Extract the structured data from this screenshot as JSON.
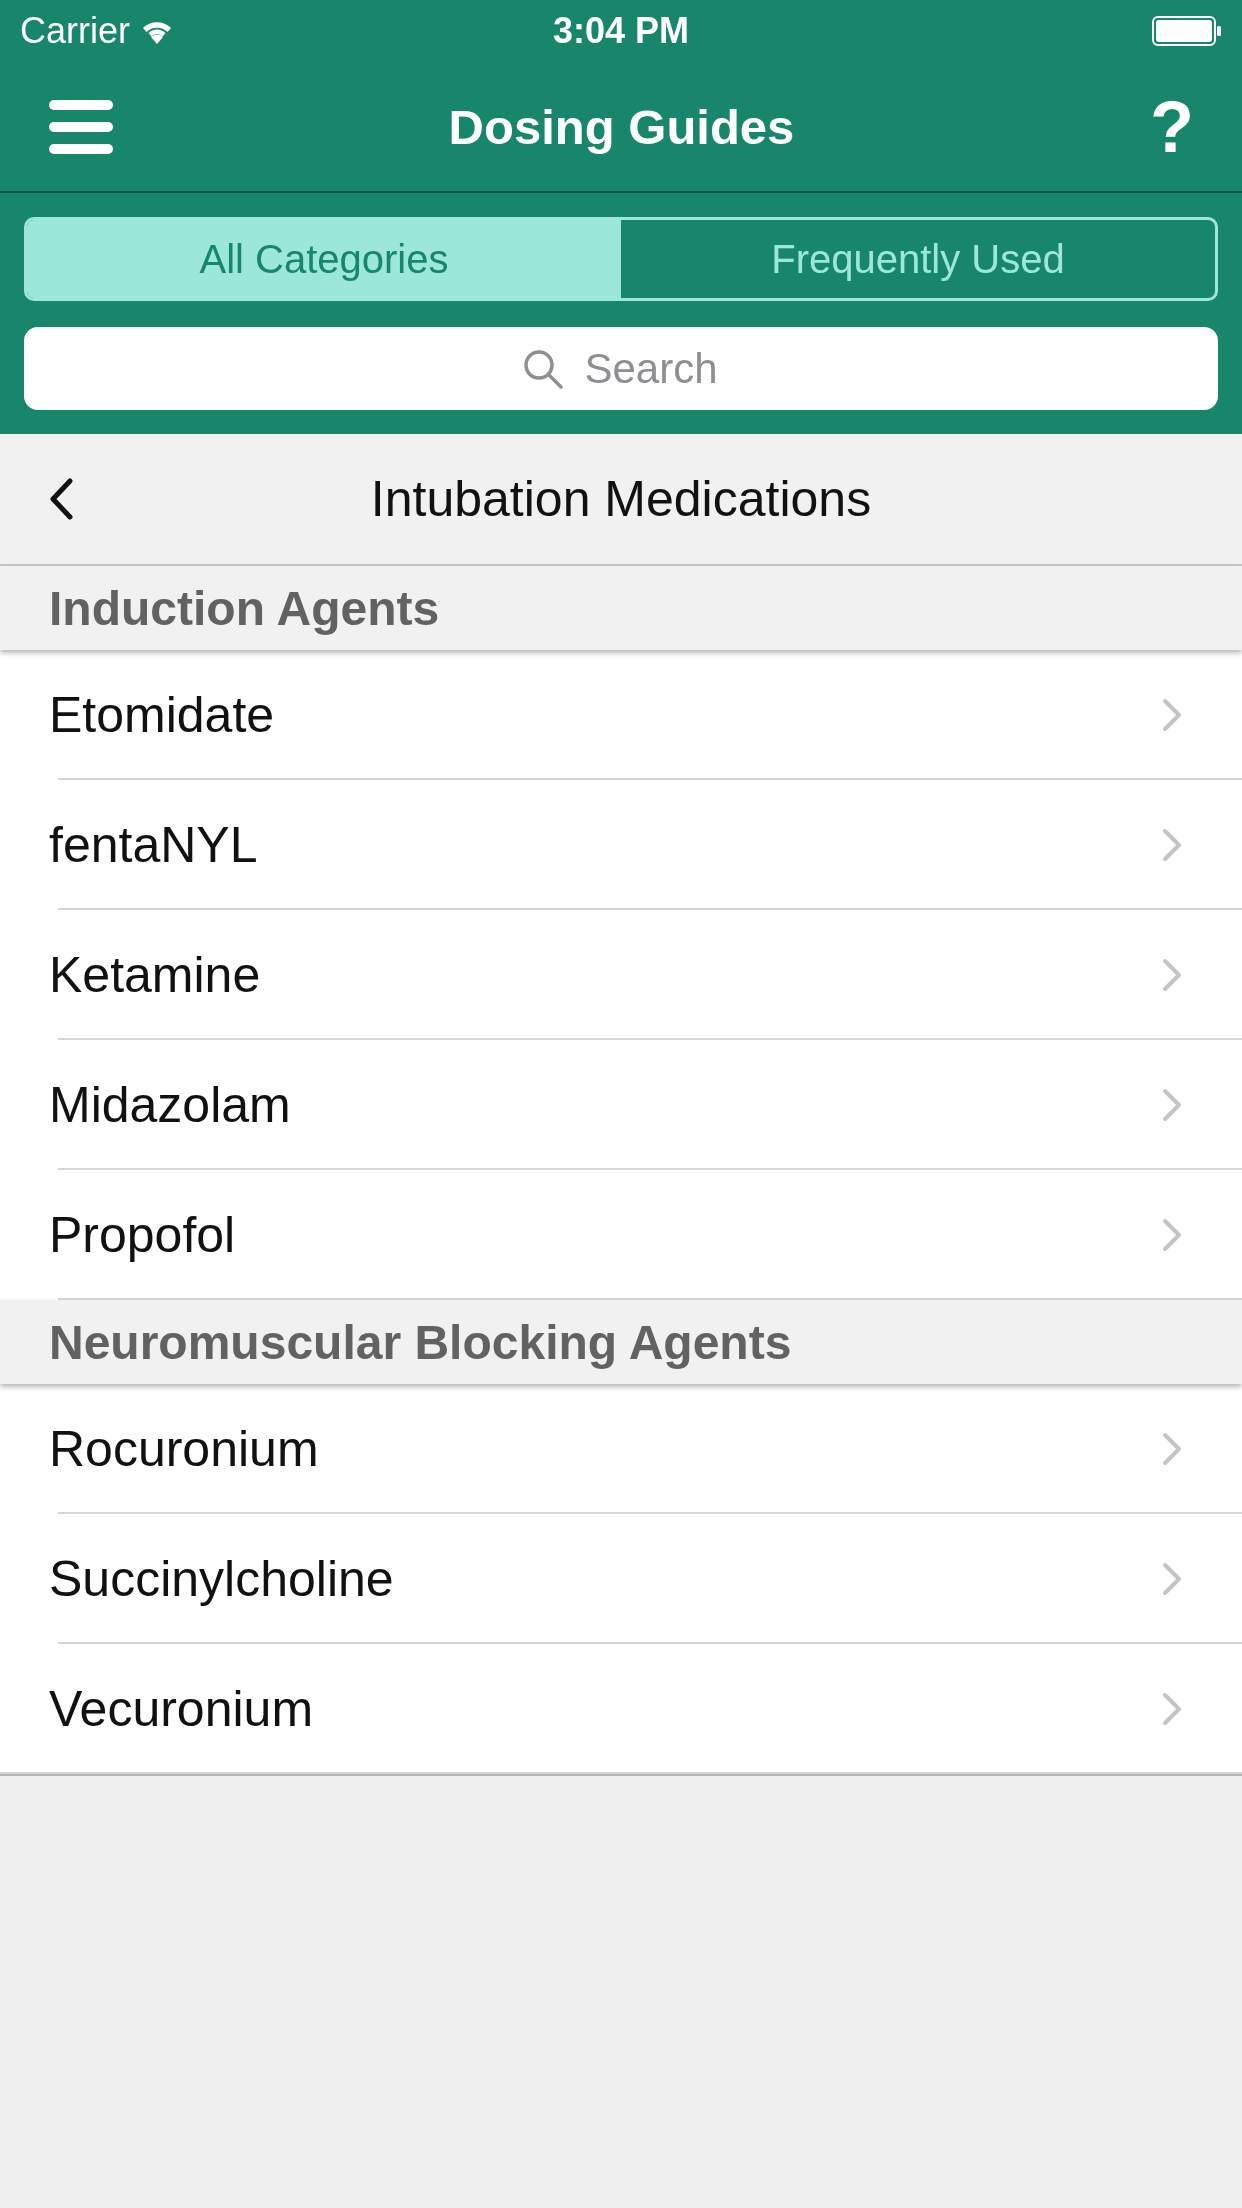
{
  "status_bar": {
    "carrier": "Carrier",
    "time": "3:04 PM"
  },
  "header": {
    "title": "Dosing Guides",
    "help_label": "?"
  },
  "tabs": [
    {
      "label": "All Categories",
      "selected": true
    },
    {
      "label": "Frequently Used",
      "selected": false
    }
  ],
  "search": {
    "placeholder": "Search"
  },
  "subheader": {
    "title": "Intubation Medications"
  },
  "sections": [
    {
      "title": "Induction Agents",
      "items": [
        {
          "label": "Etomidate"
        },
        {
          "label": "fentaNYL"
        },
        {
          "label": "Ketamine"
        },
        {
          "label": "Midazolam"
        },
        {
          "label": "Propofol"
        }
      ]
    },
    {
      "title": "Neuromuscular Blocking Agents",
      "items": [
        {
          "label": "Rocuronium"
        },
        {
          "label": "Succinylcholine"
        },
        {
          "label": "Vecuronium"
        }
      ]
    }
  ]
}
